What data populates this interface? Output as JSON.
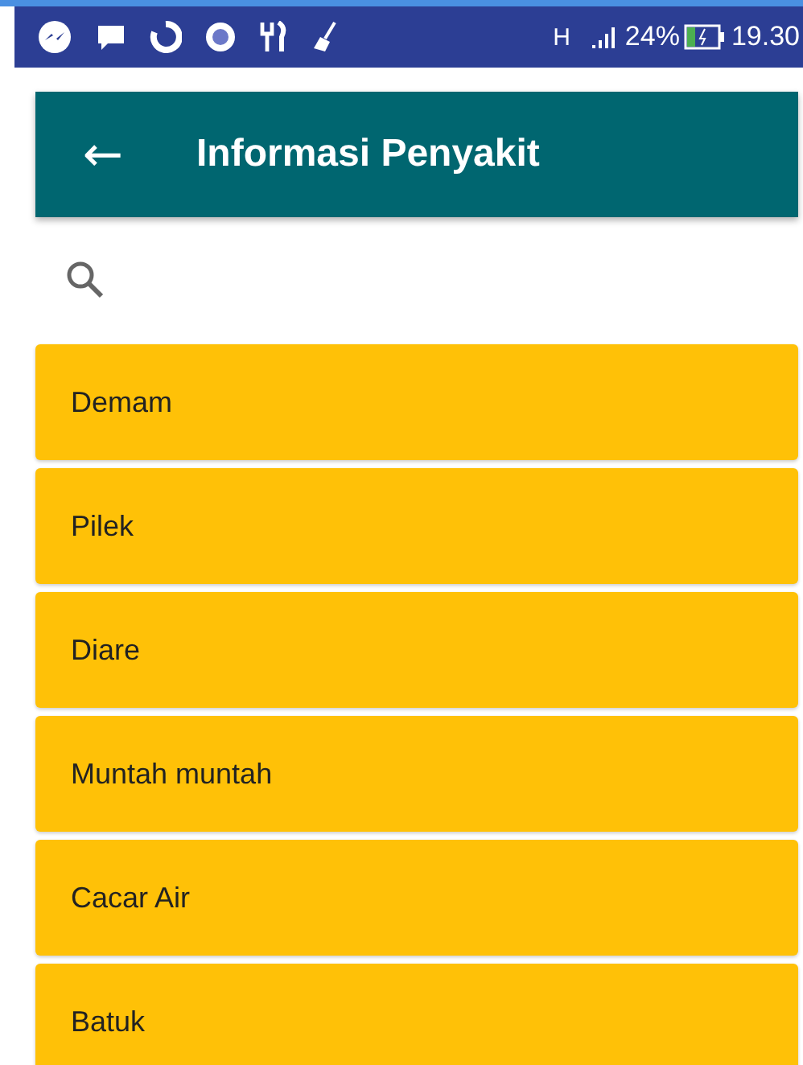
{
  "status_bar": {
    "network": "H",
    "battery": "24%",
    "time": "19.30"
  },
  "app_bar": {
    "back": "←",
    "title": "Informasi Penyakit"
  },
  "search": {
    "kind": "search"
  },
  "diseases": [
    {
      "name": "Demam"
    },
    {
      "name": "Pilek"
    },
    {
      "name": "Diare"
    },
    {
      "name": "Muntah muntah"
    },
    {
      "name": "Cacar Air"
    },
    {
      "name": "Batuk"
    }
  ]
}
